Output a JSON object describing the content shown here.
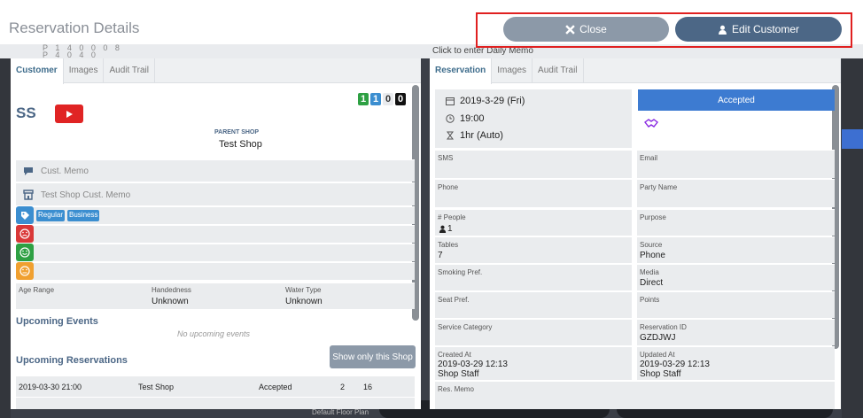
{
  "header": {
    "title": "Reservation Details",
    "close_label": "Close",
    "edit_customer_label": "Edit Customer"
  },
  "background": {
    "mini_row_1": "P 1 4 0 0 0 8",
    "mini_row_2": "P 4  0  4  0",
    "daily_memo": "Click to enter Daily Memo",
    "floor_plan": "Default Floor Plan"
  },
  "customer_panel": {
    "tabs": [
      "Customer",
      "Images",
      "Audit Trail"
    ],
    "initials": "SS",
    "counters": [
      {
        "value": "1",
        "color": "#2ea043"
      },
      {
        "value": "1",
        "color": "#3b8ed0"
      },
      {
        "value": "0",
        "color": "#e9ebee"
      },
      {
        "value": "0",
        "color": "#111111"
      }
    ],
    "parent_shop_label": "PARENT SHOP",
    "parent_shop_name": "Test Shop",
    "cust_memo": "Cust. Memo",
    "shop_cust_memo": "Test Shop Cust. Memo",
    "tags": [
      "Regular",
      "Business"
    ],
    "age_range_label": "Age Range",
    "age_range_value": "",
    "handedness_label": "Handedness",
    "handedness_value": "Unknown",
    "water_type_label": "Water Type",
    "water_type_value": "Unknown",
    "upcoming_events_title": "Upcoming Events",
    "no_events_text": "No upcoming events",
    "upcoming_reservations_title": "Upcoming Reservations",
    "show_only_shop_label": "Show only this Shop",
    "reservations": [
      {
        "datetime": "2019-03-30 21:00",
        "shop": "Test Shop",
        "status": "Accepted",
        "people": "2",
        "table": "16"
      }
    ]
  },
  "reservation_panel": {
    "tabs": [
      "Reservation",
      "Images",
      "Audit Trail"
    ],
    "date": "2019-3-29 (Fri)",
    "time": "19:00",
    "duration": "1hr (Auto)",
    "status_label": "Accepted",
    "fields": {
      "sms_label": "SMS",
      "sms_value": "",
      "email_label": "Email",
      "email_value": "",
      "phone_label": "Phone",
      "phone_value": "",
      "party_name_label": "Party Name",
      "party_name_value": "",
      "people_label": "# People",
      "people_value": "1",
      "purpose_label": "Purpose",
      "purpose_value": "",
      "tables_label": "Tables",
      "tables_value": "7",
      "source_label": "Source",
      "source_value": "Phone",
      "smoking_label": "Smoking Pref.",
      "smoking_value": "",
      "media_label": "Media",
      "media_value": "Direct",
      "seat_label": "Seat Pref.",
      "seat_value": "",
      "points_label": "Points",
      "points_value": "",
      "service_label": "Service Category",
      "service_value": "",
      "reservation_id_label": "Reservation ID",
      "reservation_id_value": "GZDJWJ",
      "created_label": "Created At",
      "created_date": "2019-03-29 12:13",
      "created_by": "Shop Staff",
      "updated_label": "Updated At",
      "updated_date": "2019-03-29 12:13",
      "updated_by": "Shop Staff",
      "res_memo_label": "Res. Memo"
    }
  },
  "colors": {
    "accent": "#4c6786",
    "status_blue": "#3d7bd1",
    "highlight_red": "#e02020"
  }
}
